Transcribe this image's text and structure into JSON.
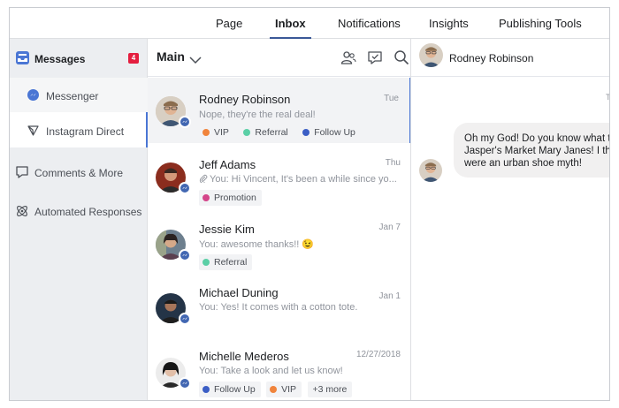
{
  "nav": {
    "tabs": [
      {
        "label": "Page"
      },
      {
        "label": "Inbox"
      },
      {
        "label": "Notifications"
      },
      {
        "label": "Insights"
      },
      {
        "label": "Publishing Tools"
      }
    ],
    "active_tab": "Inbox"
  },
  "sidebar": {
    "messages_label": "Messages",
    "messages_badge": "4",
    "messenger_label": "Messenger",
    "instagram_label": "Instagram Direct",
    "comments_label": "Comments & More",
    "automated_label": "Automated Responses"
  },
  "list": {
    "title": "Main",
    "conversations": [
      {
        "name": "Rodney Robinson",
        "date": "Tue",
        "snippet": "Nope, they're the real deal!",
        "tags": [
          {
            "label": "VIP",
            "color": "#f0843c"
          },
          {
            "label": "Referral",
            "color": "#5bcfa6"
          },
          {
            "label": "Follow Up",
            "color": "#3b5ec5"
          }
        ]
      },
      {
        "name": "Jeff Adams",
        "date": "Thu",
        "snippet": "You: Hi Vincent, It's been a while since yo...",
        "tags": [
          {
            "label": "Promotion",
            "color": "#d4468a"
          }
        ]
      },
      {
        "name": "Jessie Kim",
        "date": "Jan 7",
        "snippet": "You: awesome thanks!! 😉",
        "tags": [
          {
            "label": "Referral",
            "color": "#5bcfa6"
          }
        ]
      },
      {
        "name": "Michael Duning",
        "date": "Jan 1",
        "snippet": "You: Yes! It comes with a cotton tote.",
        "tags": []
      },
      {
        "name": "Michelle Mederos",
        "date": "12/27/2018",
        "snippet": "You: Take a look and let us know!",
        "tags": [
          {
            "label": "Follow Up",
            "color": "#3b5ec5"
          },
          {
            "label": "VIP",
            "color": "#f0843c"
          }
        ],
        "more": "+3 more"
      }
    ]
  },
  "chat": {
    "name": "Rodney Robinson",
    "time": "T",
    "message_lines": [
      "Oh my God! Do you know what t",
      "Jasper's Market Mary Janes! I th",
      "were an urban shoe myth!"
    ]
  },
  "colors": {
    "accent": "#4267b2",
    "badge": "#e41e3f"
  },
  "icons": {
    "messages": "inbox-tray-icon",
    "messenger": "messenger-icon",
    "instagram": "paper-plane-icon",
    "comments": "speech-bubble-icon",
    "automated": "atom-icon",
    "list_dropdown": "chevron-down-icon",
    "assign": "people-icon",
    "mark_done": "check-bubble-icon",
    "search": "search-icon",
    "attachment": "paperclip-icon"
  }
}
